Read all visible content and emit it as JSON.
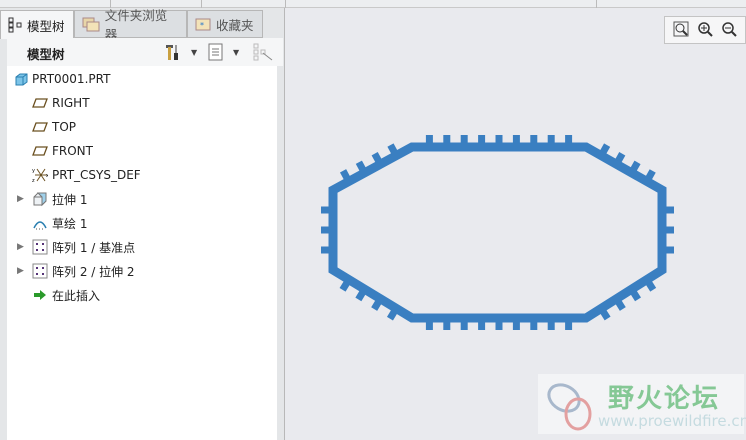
{
  "tabs": [
    {
      "label": "模型树",
      "icon": "model-tree-icon"
    },
    {
      "label": "文件夹浏览器",
      "icon": "folder-icon"
    },
    {
      "label": "收藏夹",
      "icon": "favorites-icon"
    }
  ],
  "panel_title": "模型树",
  "tree": [
    {
      "label": "PRT0001.PRT",
      "icon": "part-icon",
      "expandable": false
    },
    {
      "label": "RIGHT",
      "icon": "datum-plane-icon",
      "expandable": false
    },
    {
      "label": "TOP",
      "icon": "datum-plane-icon",
      "expandable": false
    },
    {
      "label": "FRONT",
      "icon": "datum-plane-icon",
      "expandable": false
    },
    {
      "label": "PRT_CSYS_DEF",
      "icon": "csys-icon",
      "expandable": false
    },
    {
      "label": "拉伸 1",
      "icon": "extrude-icon",
      "expandable": true
    },
    {
      "label": "草绘 1",
      "icon": "sketch-icon",
      "expandable": false
    },
    {
      "label": "阵列 1 / 基准点",
      "icon": "pattern-icon",
      "expandable": true
    },
    {
      "label": "阵列 2 / 拉伸 2",
      "icon": "pattern-icon",
      "expandable": true
    },
    {
      "label": "在此插入",
      "icon": "insert-here-arrow-icon",
      "expandable": false
    }
  ],
  "watermark": {
    "name": "野火论坛",
    "url": "www.proewildfire.cn"
  },
  "colors": {
    "model": "#3a7fc1"
  }
}
